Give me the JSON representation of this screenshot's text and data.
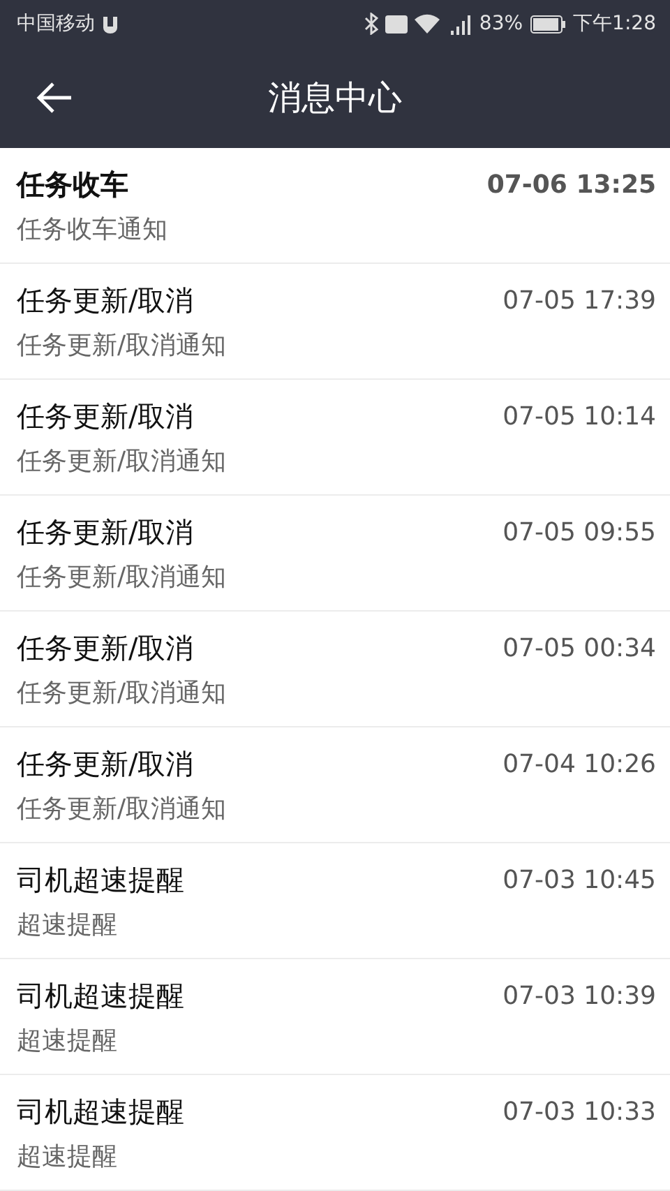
{
  "status_bar": {
    "carrier": "中国移动",
    "battery": "83%",
    "time": "下午1:28"
  },
  "header": {
    "title": "消息中心"
  },
  "messages": [
    {
      "title": "任务收车",
      "subtitle": "任务收车通知",
      "time": "07-06 13:25",
      "unread": true
    },
    {
      "title": "任务更新/取消",
      "subtitle": "任务更新/取消通知",
      "time": "07-05 17:39",
      "unread": false
    },
    {
      "title": "任务更新/取消",
      "subtitle": "任务更新/取消通知",
      "time": "07-05 10:14",
      "unread": false
    },
    {
      "title": "任务更新/取消",
      "subtitle": "任务更新/取消通知",
      "time": "07-05 09:55",
      "unread": false
    },
    {
      "title": "任务更新/取消",
      "subtitle": "任务更新/取消通知",
      "time": "07-05 00:34",
      "unread": false
    },
    {
      "title": "任务更新/取消",
      "subtitle": "任务更新/取消通知",
      "time": "07-04 10:26",
      "unread": false
    },
    {
      "title": "司机超速提醒",
      "subtitle": "超速提醒",
      "time": "07-03 10:45",
      "unread": false
    },
    {
      "title": "司机超速提醒",
      "subtitle": "超速提醒",
      "time": "07-03 10:39",
      "unread": false
    },
    {
      "title": "司机超速提醒",
      "subtitle": "超速提醒",
      "time": "07-03 10:33",
      "unread": false
    }
  ]
}
